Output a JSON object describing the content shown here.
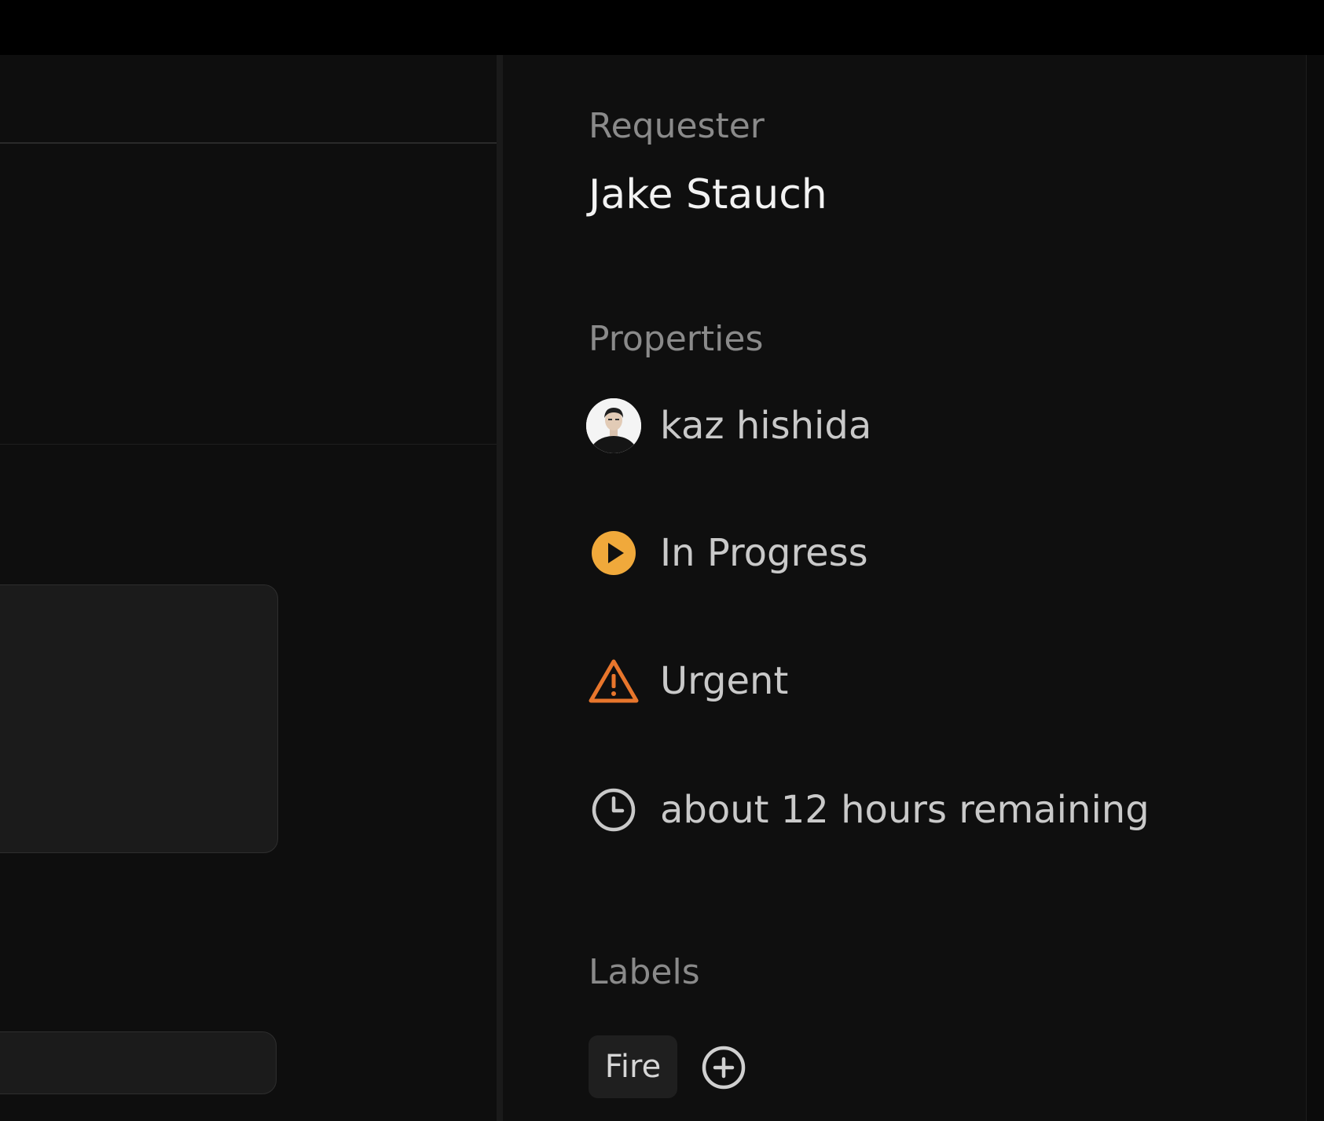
{
  "sidebar": {
    "requester": {
      "heading": "Requester",
      "name": "Jake Stauch"
    },
    "properties": {
      "heading": "Properties",
      "assignee": "kaz hishida",
      "status": "In Progress",
      "priority": "Urgent",
      "time_remaining": "about 12 hours remaining"
    },
    "labels": {
      "heading": "Labels",
      "items": [
        "Fire"
      ]
    }
  },
  "icons": {
    "assignee": "user-avatar",
    "status": "play-circle-icon",
    "priority": "warning-triangle-icon",
    "time": "clock-icon",
    "add_label": "plus-circle-icon"
  },
  "colors": {
    "status_in_progress": "#f0a93b",
    "priority_urgent": "#e8762c",
    "background": "#0f0f0f",
    "text_primary": "#f2f2f2",
    "text_secondary": "#8a8a8a"
  }
}
